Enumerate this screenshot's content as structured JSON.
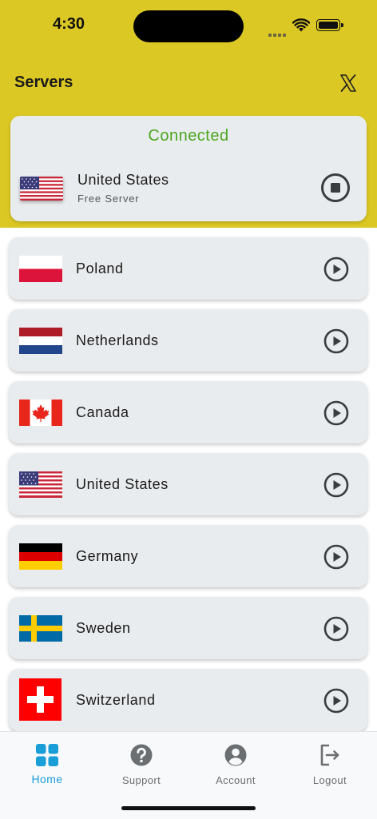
{
  "status_bar": {
    "time": "4:30"
  },
  "header": {
    "title": "Servers",
    "x_icon": "x-logo-icon"
  },
  "connection": {
    "status": "Connected",
    "country": "United States",
    "subtitle": "Free Server",
    "status_color": "#4ca61f",
    "action_icon": "stop-circle-icon"
  },
  "servers": [
    {
      "name": "Poland",
      "flag": "flag-poland",
      "icon": "play-circle-icon"
    },
    {
      "name": "Netherlands",
      "flag": "flag-netherlands",
      "icon": "play-circle-icon"
    },
    {
      "name": "Canada",
      "flag": "flag-canada",
      "icon": "play-circle-icon"
    },
    {
      "name": "United States",
      "flag": "flag-united-states",
      "icon": "play-circle-icon"
    },
    {
      "name": "Germany",
      "flag": "flag-germany",
      "icon": "play-circle-icon"
    },
    {
      "name": "Sweden",
      "flag": "flag-sweden",
      "icon": "play-circle-icon"
    },
    {
      "name": "Switzerland",
      "flag": "flag-switzerland",
      "icon": "play-circle-icon"
    }
  ],
  "tabs": [
    {
      "label": "Home",
      "icon": "grid-icon",
      "active": true
    },
    {
      "label": "Support",
      "icon": "help-circle-icon",
      "active": false
    },
    {
      "label": "Account",
      "icon": "account-circle-icon",
      "active": false
    },
    {
      "label": "Logout",
      "icon": "logout-icon",
      "active": false
    }
  ],
  "colors": {
    "header_bg": "#dcc824",
    "accent": "#1a9ed8",
    "card_bg": "#e9ecee"
  }
}
